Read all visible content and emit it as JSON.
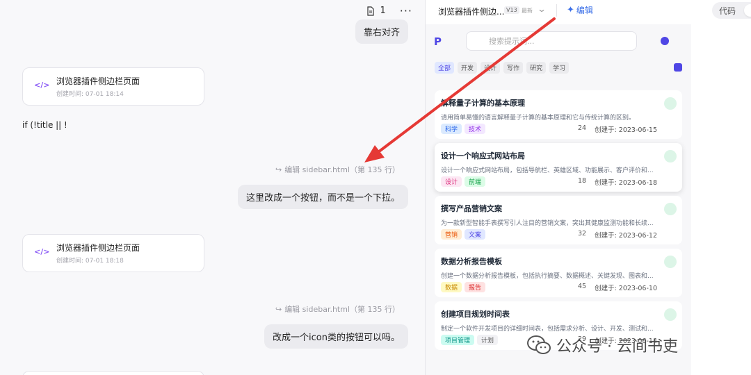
{
  "chat": {
    "doc_count": "1",
    "more": "···",
    "msg1": "靠右对齐",
    "artifact1": {
      "title": "浏览器插件侧边栏页面",
      "time": "创建时间:  07-01 18:14"
    },
    "plain_text": "if (!title || !",
    "edit_ref1": "编辑 sidebar.html（第 135 行）",
    "msg2": "这里改成一个按钮，而不是一个下拉。",
    "artifact2": {
      "title": "浏览器插件侧边栏页面",
      "time": "创建时间:  07-01 18:18"
    },
    "edit_ref2": "编辑 sidebar.html（第 135 行）",
    "msg3": "改成一个icon类的按钮可以吗。"
  },
  "preview": {
    "title": "浏览器插件侧边...",
    "version": "V13",
    "latest": "最新",
    "edit_label": "编辑",
    "seg_code": "代码",
    "seg_preview": "",
    "logo": "P",
    "search_placeholder": "搜索提示词...",
    "filters": [
      "全部",
      "开发",
      "设计",
      "写作",
      "研究",
      "学习"
    ],
    "cards": [
      {
        "title": "解释量子计算的基本原理",
        "desc": "请用简单易懂的语言解释量子计算的基本原理和它与传统计算的区别。",
        "tags": [
          "科学",
          "技术"
        ],
        "count": "24",
        "created": "创建于: 2023-06-15"
      },
      {
        "title": "设计一个响应式网站布局",
        "desc": "设计一个响应式网站布局，包括导航栏、英雄区域、功能展示、客户评价和...",
        "tags": [
          "设计",
          "前端"
        ],
        "count": "18",
        "created": "创建于: 2023-06-18"
      },
      {
        "title": "撰写产品营销文案",
        "desc": "为一款新型智能手表撰写引人注目的营销文案，突出其健康监测功能和长续...",
        "tags": [
          "营销",
          "文案"
        ],
        "count": "32",
        "created": "创建于: 2023-06-12"
      },
      {
        "title": "数据分析报告模板",
        "desc": "创建一个数据分析报告模板，包括执行摘要、数据概述、关键发现、图表和...",
        "tags": [
          "数据",
          "报告"
        ],
        "count": "45",
        "created": "创建于: 2023-06-10"
      },
      {
        "title": "创建项目规划时间表",
        "desc": "制定一个软件开发项目的详细时间表，包括需求分析、设计、开发、测试和...",
        "tags": [
          "项目管理",
          "计划"
        ],
        "count": "29",
        "created": "创建于: 2023-06-14"
      }
    ]
  },
  "watermark": "公众号 · 云间书吏",
  "colors": {
    "accent": "#4f46e5",
    "edit_blue": "#3b6fe8",
    "annotation": "#e53935"
  }
}
